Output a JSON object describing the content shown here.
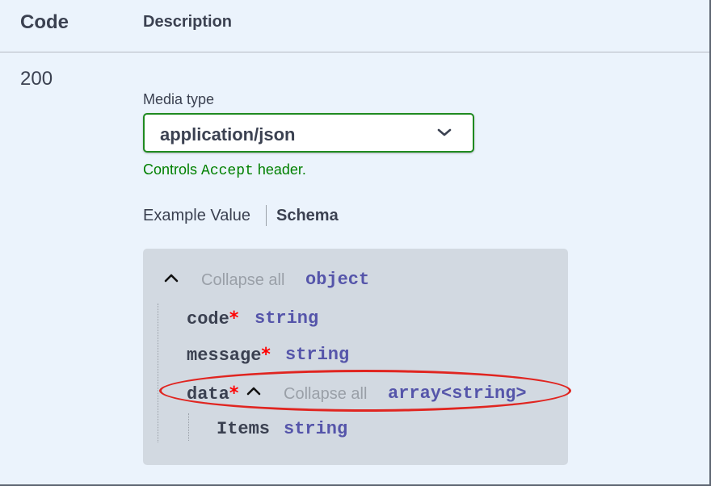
{
  "header": {
    "code": "Code",
    "description": "Description"
  },
  "response": {
    "status": "200",
    "media_type_label": "Media type",
    "media_type_value": "application/json",
    "controls_prefix": "Controls ",
    "controls_code": "Accept",
    "controls_suffix": " header."
  },
  "tabs": {
    "example": "Example Value",
    "schema": "Schema"
  },
  "schema": {
    "collapse_all": "Collapse all",
    "root_type": "object",
    "required_mark": "*",
    "fields": [
      {
        "name": "code",
        "type": "string"
      },
      {
        "name": "message",
        "type": "string"
      },
      {
        "name": "data",
        "type": "array<string>"
      }
    ],
    "items_label": "Items",
    "items_type": "string"
  },
  "colors": {
    "accent_green": "#1f8a20",
    "type_purple": "#5555aa",
    "required_red": "#ff0000",
    "highlight_red": "#e02520"
  }
}
